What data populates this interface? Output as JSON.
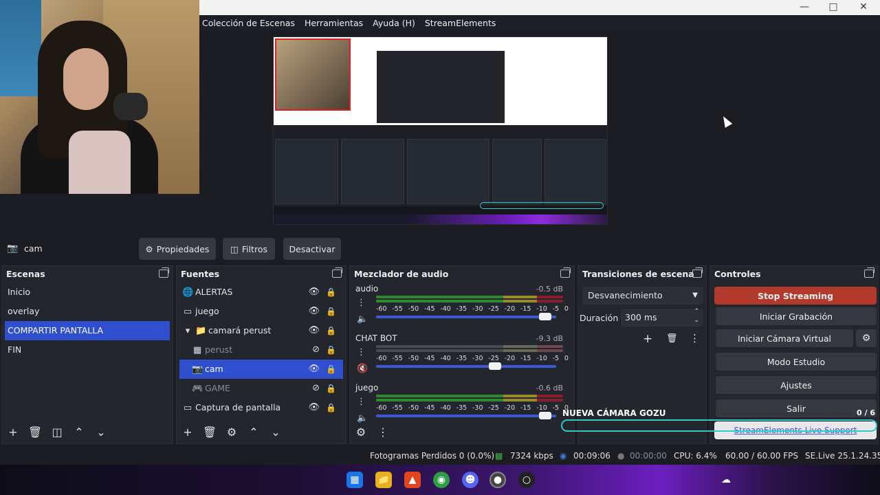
{
  "menubar": [
    "Colección de Escenas",
    "Herramientas",
    "Ayuda (H)",
    "StreamElements"
  ],
  "source_toolbar": {
    "source_name": "cam",
    "properties_label": "Propiedades",
    "filters_label": "Filtros",
    "deactivate_label": "Desactivar"
  },
  "scenes": {
    "title": "Escenas",
    "items": [
      "Inicio",
      "overlay",
      "COMPARTIR PANTALLA",
      "FIN"
    ],
    "selected": "COMPARTIR PANTALLA"
  },
  "sources": {
    "title": "Fuentes",
    "items": [
      {
        "label": "ALERTAS",
        "icon": "globe-icon",
        "visible": true
      },
      {
        "label": "juego",
        "icon": "window-icon",
        "visible": true
      },
      {
        "label": "camará perust",
        "icon": "folder-icon",
        "visible": true,
        "group": true
      },
      {
        "label": "perust",
        "icon": "image-icon",
        "visible": false
      },
      {
        "label": "cam",
        "icon": "camera-icon",
        "visible": true,
        "selected": true
      },
      {
        "label": "GAME",
        "icon": "gamepad-icon",
        "visible": false
      },
      {
        "label": "Captura de pantalla",
        "icon": "monitor-icon",
        "visible": true
      }
    ]
  },
  "mixer": {
    "title": "Mezclador de audio",
    "ticks": [
      "-60",
      "-55",
      "-50",
      "-45",
      "-40",
      "-35",
      "-30",
      "-25",
      "-20",
      "-15",
      "-10",
      "-5",
      "0"
    ],
    "channels": [
      {
        "name": "audio",
        "db": "-0.5 dB",
        "volume": 0.94,
        "muted": false
      },
      {
        "name": "CHAT BOT",
        "db": "-9.3 dB",
        "volume": 0.66,
        "muted": true
      },
      {
        "name": "juego",
        "db": "-0.6 dB",
        "volume": 0.94,
        "muted": false
      }
    ]
  },
  "transitions": {
    "title": "Transiciones de escena",
    "selected": "Desvanecimiento",
    "duration_label": "Duración",
    "duration_value": "300 ms"
  },
  "controls": {
    "title": "Controles",
    "stop_streaming": "Stop Streaming",
    "start_recording": "Iniciar Grabación",
    "virtual_camera": "Iniciar Cámara Virtual",
    "studio_mode": "Modo Estudio",
    "settings": "Ajustes",
    "exit": "Salir",
    "live_support": "StreamElements Live Support"
  },
  "status": {
    "dropped_frames": "Fotogramas Perdidos 0 (0.0%)",
    "bitrate": "7324 kbps",
    "stream_time": "00:09:06",
    "record_time": "00:00:00",
    "cpu": "CPU: 6.4%",
    "fps": "60.00 / 60.00 FPS",
    "version": "SE.Live 25.1.24.350"
  },
  "overlay": {
    "title": "NUEVA CÁMARA GOZU",
    "count": "0 / 6"
  },
  "colors": {
    "accent": "#2f4fcf",
    "stop_streaming_bg": "#b23a2c",
    "panel_bg": "#24262d"
  }
}
